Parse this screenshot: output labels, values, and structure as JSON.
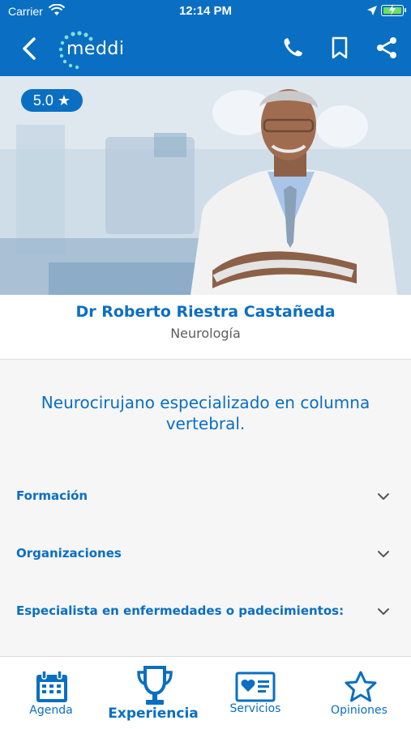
{
  "status": {
    "carrier": "Carrier",
    "time": "12:14 PM"
  },
  "header": {
    "logo_text": "meddi"
  },
  "doctor": {
    "rating": "5.0 ★",
    "name": "Dr Roberto Riestra Castañeda",
    "specialty": "Neurología",
    "bio": "Neurocirujano especializado en columna vertebral."
  },
  "sections": [
    {
      "label": "Formación"
    },
    {
      "label": "Organizaciones"
    },
    {
      "label": "Especialista en enfermedades o padecimientos:"
    }
  ],
  "tabs": [
    {
      "label": "Agenda",
      "icon": "calendar-icon"
    },
    {
      "label": "Experiencia",
      "icon": "trophy-icon",
      "active": true
    },
    {
      "label": "Servicios",
      "icon": "services-card-icon"
    },
    {
      "label": "Opiniones",
      "icon": "star-icon"
    }
  ],
  "colors": {
    "brand": "#0a6fc2",
    "background": "#f6f6f6",
    "battery": "#6fe05d"
  }
}
